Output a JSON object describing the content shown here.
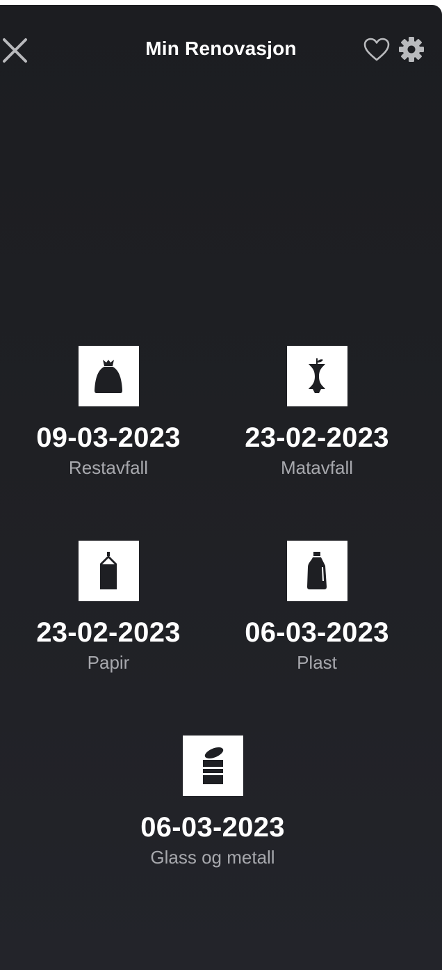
{
  "header": {
    "title": "Min Renovasjon",
    "close_icon": "close-icon",
    "favorite_icon": "heart-outline-icon",
    "settings_icon": "gear-icon"
  },
  "colors": {
    "background": "#1e1f23",
    "text": "#ffffff",
    "label": "#a7a8ad",
    "icon_tile": "#ffffff",
    "icon": "#1e1f23"
  },
  "pickups": [
    {
      "date": "09-03-2023",
      "label": "Restavfall",
      "icon": "trash-bag-icon"
    },
    {
      "date": "23-02-2023",
      "label": "Matavfall",
      "icon": "apple-core-icon"
    },
    {
      "date": "23-02-2023",
      "label": "Papir",
      "icon": "milk-carton-icon"
    },
    {
      "date": "06-03-2023",
      "label": "Plast",
      "icon": "plastic-bottle-icon"
    },
    {
      "date": "06-03-2023",
      "label": "Glass og metall",
      "icon": "can-jar-icon"
    }
  ]
}
